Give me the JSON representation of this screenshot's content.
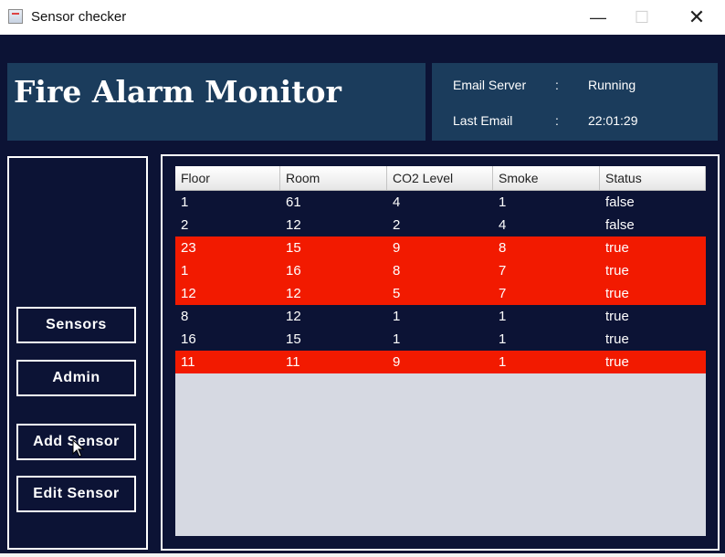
{
  "window": {
    "title": "Sensor checker",
    "minimize": "—",
    "maximize": "☐",
    "close": "✕"
  },
  "header": {
    "title": "Fire Alarm Monitor",
    "info": [
      {
        "label": "Email Server",
        "sep": ":",
        "value": "Running"
      },
      {
        "label": "Last Email",
        "sep": ":",
        "value": "22:01:29"
      }
    ]
  },
  "sidebar": {
    "buttons": [
      "Sensors",
      "Admin",
      "Add Sensor",
      "Edit Sensor"
    ]
  },
  "table": {
    "columns": [
      "Floor",
      "Room",
      "CO2 Level",
      "Smoke",
      "Status"
    ],
    "rows": [
      [
        "1",
        "61",
        "4",
        "1",
        "false"
      ],
      [
        "2",
        "12",
        "2",
        "4",
        "false"
      ],
      [
        "23",
        "15",
        "9",
        "8",
        "true"
      ],
      [
        "1",
        "16",
        "8",
        "7",
        "true"
      ],
      [
        "12",
        "12",
        "5",
        "7",
        "true"
      ],
      [
        "8",
        "12",
        "1",
        "1",
        "true"
      ],
      [
        "16",
        "15",
        "1",
        "1",
        "true"
      ],
      [
        "11",
        "11",
        "9",
        "1",
        "true"
      ]
    ],
    "row_alert": [
      false,
      false,
      true,
      true,
      true,
      false,
      false,
      true
    ]
  },
  "colors": {
    "background": "#0c1335",
    "header": "#1b3c5c",
    "row_normal": "#0c1335",
    "row_alert": "#f21a00",
    "table_empty": "#d6d9e2"
  }
}
